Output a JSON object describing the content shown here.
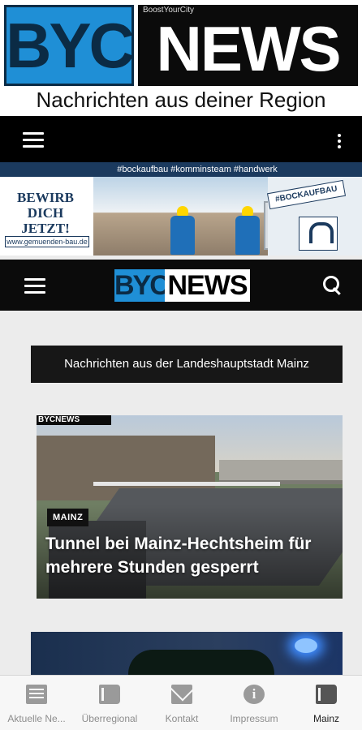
{
  "masthead": {
    "logo_left": "BYC",
    "logo_right": "NEWS",
    "logo_small": "BoostYourCity",
    "tagline": "Nachrichten aus deiner Region"
  },
  "ad_banner": {
    "hashtags": "#bockaufbau #komminsteam #handwerk",
    "cta": "BEWIRB DICH JETZT!",
    "url": "www.gemuenden-bau.de",
    "tag": "#BOCKAUFBAU"
  },
  "nav": {
    "logo_left": "BYC",
    "logo_right": "NEWS"
  },
  "section": {
    "title": "Nachrichten aus der Landeshauptstadt Mainz"
  },
  "articles": [
    {
      "category": "MAINZ",
      "headline": "Tunnel bei Mainz-Hechtsheim für mehrere Stunden gesperrt",
      "watermark": "BYCNEWS"
    }
  ],
  "bottom_nav": {
    "tabs": [
      {
        "label": "Aktuelle Ne...",
        "icon": "newspaper-icon",
        "active": false
      },
      {
        "label": "Überregional",
        "icon": "book-icon",
        "active": false
      },
      {
        "label": "Kontakt",
        "icon": "mail-icon",
        "active": false
      },
      {
        "label": "Impressum",
        "icon": "info-icon",
        "active": false
      },
      {
        "label": "Mainz",
        "icon": "book-icon",
        "active": true
      }
    ]
  },
  "colors": {
    "brand_blue": "#1f8fd6",
    "brand_dark": "#0b2b45",
    "nav_bg": "#000000"
  }
}
